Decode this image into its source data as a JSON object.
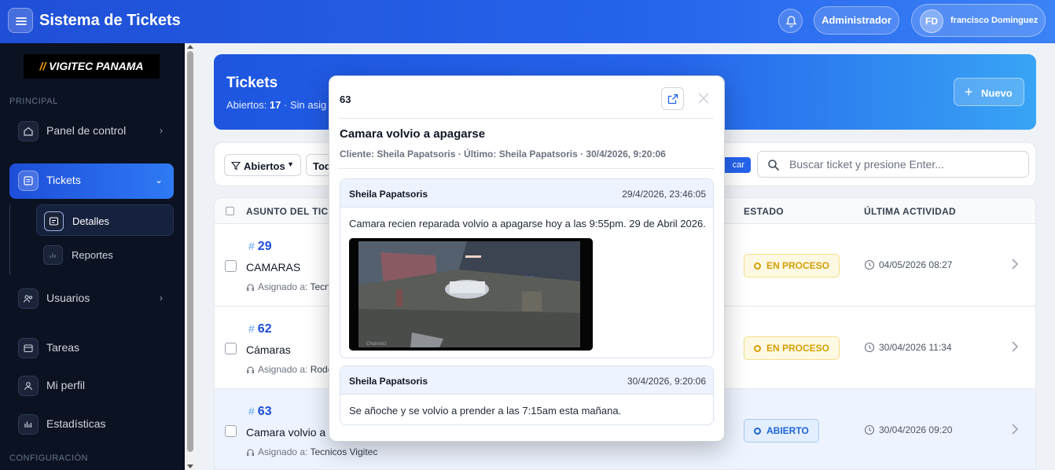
{
  "header": {
    "app_title": "Sistema de Tickets",
    "role_label": "Administrador",
    "user_initials": "FD",
    "user_name": "francisco Dominguez",
    "brand_color": "#2563eb"
  },
  "sidebar": {
    "logo_slash": "//",
    "logo_text": " VIGITEC PANAMA",
    "section_principal": "PRINCIPAL",
    "section_config": "CONFIGURACIÓN",
    "items": [
      {
        "label": "Panel de control",
        "icon": "home-icon"
      },
      {
        "label": "Tickets",
        "icon": "ticket-icon"
      },
      {
        "label": "Usuarios",
        "icon": "users-icon"
      },
      {
        "label": "Tareas",
        "icon": "tasks-icon"
      },
      {
        "label": "Mi perfil",
        "icon": "user-icon"
      },
      {
        "label": "Estadísticas",
        "icon": "stats-icon"
      }
    ],
    "sub_items": [
      {
        "label": "Detalles",
        "icon": "details-icon"
      },
      {
        "label": "Reportes",
        "icon": "reports-icon"
      }
    ]
  },
  "hero": {
    "title": "Tickets",
    "open_label": "Abiertos: ",
    "open_count": "17",
    "unassigned_label": " · Sin asig",
    "new_button": "Nuevo"
  },
  "filters": {
    "status_filter": "Abiertos",
    "second_filter": "Tod",
    "search_button": "car",
    "search_placeholder": "Buscar ticket y presione Enter..."
  },
  "table": {
    "columns": [
      "ASUNTO DEL TICK",
      "ESTADO",
      "ÚLTIMA ACTIVIDAD"
    ],
    "assigned_prefix": "Asignado a: ",
    "rows": [
      {
        "number": "29",
        "subject": "CAMARAS",
        "assigned": "Tecni",
        "status": "EN PROCESO",
        "last_activity": "04/05/2026 08:27"
      },
      {
        "number": "62",
        "subject": "Cámaras",
        "assigned": "Rode",
        "status": "EN PROCESO",
        "last_activity": "30/04/2026 11:34"
      },
      {
        "number": "63",
        "subject": "Camara volvio a a",
        "assigned": "Tecnicos Vigitec",
        "status": "ABIERTO",
        "last_activity": "30/04/2026 09:20"
      }
    ]
  },
  "modal": {
    "ticket_id": "63",
    "title": "Camara volvio a apagarse",
    "meta": "Cliente: Sheila Papatsoris · Último: Sheila Papatsoris · 30/4/2026, 9:20:06",
    "messages": [
      {
        "author": "Sheila Papatsoris",
        "time": "29/4/2026, 23:46:05",
        "body": "Camara recien reparada volvio a apagarse hoy a las 9:55pm. 29 de Abril 2026.",
        "image_caption": "Channel2"
      },
      {
        "author": "Sheila Papatsoris",
        "time": "30/4/2026, 9:20:06",
        "body": "Se añoche y se volvio a prender a las 7:15am esta mañana."
      }
    ]
  }
}
